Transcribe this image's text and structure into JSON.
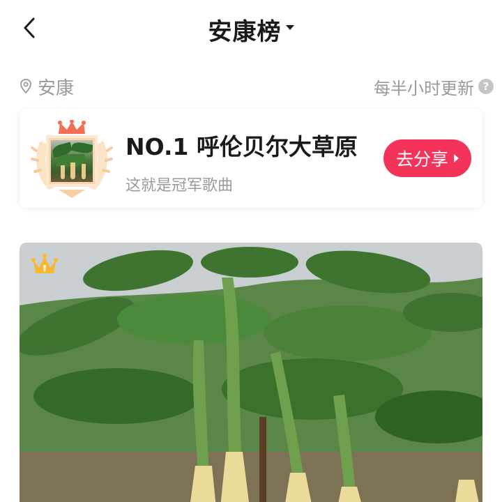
{
  "header": {
    "title": "安康榜"
  },
  "location": {
    "city": "安康",
    "update_note": "每半小时更新",
    "help_symbol": "?"
  },
  "champion": {
    "title": "NO.1 呼伦贝尔大草原",
    "subtitle": "这就是冠军歌曲",
    "share_label": "去分享"
  },
  "colors": {
    "accent": "#f4335a",
    "muted_text": "#9a9a9a",
    "crown": "#f5b82e"
  },
  "icons": [
    "back-arrow-icon",
    "dropdown-caret-icon",
    "location-pin-icon",
    "help-icon",
    "champion-badge-icon",
    "crown-icon"
  ]
}
